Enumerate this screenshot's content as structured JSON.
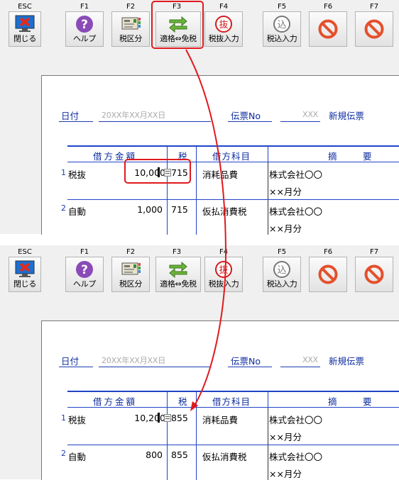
{
  "toolbar": {
    "keys": [
      {
        "key": "ESC",
        "label": "閉じる",
        "icon": "close-window-icon"
      },
      {
        "key": "F1",
        "label": "ヘルプ",
        "icon": "question-icon"
      },
      {
        "key": "F2",
        "label": "税区分",
        "icon": "tax-category-icon"
      },
      {
        "key": "F3",
        "label": "適格⇔免税",
        "icon": "swap-arrows-icon"
      },
      {
        "key": "F4",
        "label": "税抜入力",
        "icon": "tax-exclusive-icon",
        "icon_char": "抜"
      },
      {
        "key": "F5",
        "label": "税込入力",
        "icon": "tax-inclusive-icon",
        "icon_char": "込"
      },
      {
        "key": "F6",
        "label": "",
        "icon": "prohibited-icon"
      },
      {
        "key": "F7",
        "label": "",
        "icon": "prohibited-icon"
      }
    ]
  },
  "form": {
    "date_label": "日付",
    "date_value": "20XX年XX月XX日",
    "voucher_label": "伝票No",
    "voucher_value": "XXX",
    "status": "新規伝票"
  },
  "table_headers": {
    "amount": "借方金額",
    "tax": "税",
    "account": "借方科目",
    "summary": "摘　要"
  },
  "before": {
    "rows": [
      {
        "no": "1",
        "type": "税抜",
        "amount": "10,000",
        "tax": "715",
        "account": "消耗品費",
        "summary1": "株式会社〇〇",
        "summary2": "××月分"
      },
      {
        "no": "2",
        "type": "自動",
        "amount": "1,000",
        "tax": "715",
        "account": "仮払消費税",
        "summary1": "株式会社〇〇",
        "summary2": "××月分"
      }
    ]
  },
  "after": {
    "rows": [
      {
        "no": "1",
        "type": "税抜",
        "amount": "10,200",
        "tax": "855",
        "account": "消耗品費",
        "summary1": "株式会社〇〇",
        "summary2": "××月分"
      },
      {
        "no": "2",
        "type": "自動",
        "amount": "800",
        "tax": "855",
        "account": "仮払消費税",
        "summary1": "株式会社〇〇",
        "summary2": "××月分"
      }
    ]
  },
  "colors": {
    "accent": "#2044c8",
    "highlight": "#e0191e",
    "help": "#8a4bb8",
    "prohibited": "#e4502c"
  }
}
